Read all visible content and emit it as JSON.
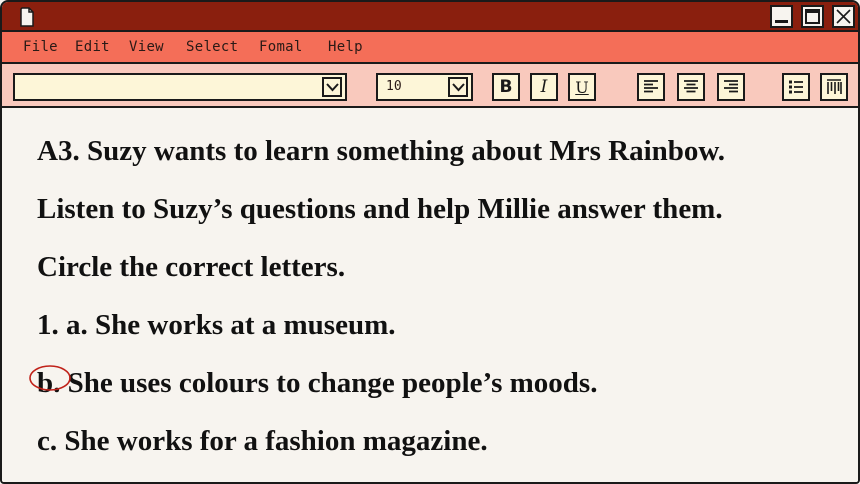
{
  "menu": {
    "file": "File",
    "edit": "Edit",
    "view": "View",
    "select": "Select",
    "format": "Fomal",
    "help": "Help"
  },
  "toolbar": {
    "font_value": "",
    "font_size": "10",
    "bold_label": "B",
    "italic_label": "I",
    "underline_label": "U"
  },
  "content": {
    "lines": [
      "A3. Suzy wants to learn something about Mrs Rainbow.",
      "Listen to Suzy’s questions and help Millie answer them.",
      "Circle the correct letters.",
      "1. a. She works at a museum.",
      "b. She uses colours to change people’s moods.",
      "c. She works for a fashion magazine."
    ],
    "circled_option": "b"
  },
  "colors": {
    "titlebar": "#8a1f0e",
    "menubar": "#f46e58",
    "toolbar": "#f9c9bd",
    "field": "#fdf6d8",
    "page": "#f7f4ef",
    "circle": "#c0221a"
  },
  "icons": {
    "window": [
      "document-icon",
      "minimize-icon",
      "maximize-icon",
      "close-icon"
    ],
    "toolbar": [
      "chevron-down-icon",
      "align-left-icon",
      "align-center-icon",
      "align-right-icon",
      "bullet-list-icon",
      "columns-icon"
    ]
  }
}
